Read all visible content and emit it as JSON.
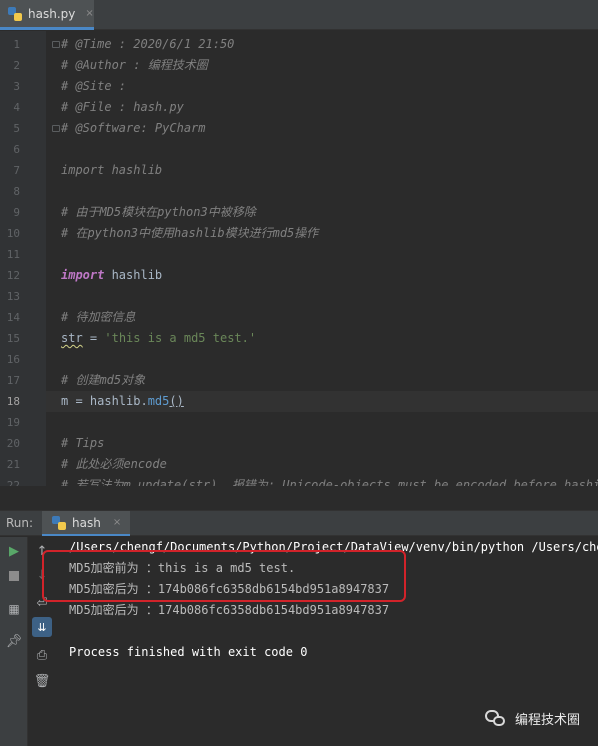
{
  "editor_tab": {
    "label": "hash.py",
    "close": "×",
    "icon": "python-file-icon"
  },
  "code": {
    "lines": [
      {
        "n": "1",
        "html": "comment",
        "text": "# @Time : 2020/6/1 21:50"
      },
      {
        "n": "2",
        "text": "# @Author : 编程技术圈"
      },
      {
        "n": "3",
        "text": "# @Site :"
      },
      {
        "n": "4",
        "text": "# @File : hash.py"
      },
      {
        "n": "5",
        "text": "# @Software: PyCharm"
      },
      {
        "n": "6",
        "text": ""
      },
      {
        "n": "7",
        "text": "import hashlib"
      },
      {
        "n": "8",
        "text": ""
      },
      {
        "n": "9",
        "text": "# 由于MD5模块在python3中被移除"
      },
      {
        "n": "10",
        "text": "# 在python3中使用hashlib模块进行md5操作"
      },
      {
        "n": "11",
        "text": ""
      },
      {
        "n": "12",
        "text": "import hashlib"
      },
      {
        "n": "13",
        "text": ""
      },
      {
        "n": "14",
        "text": "# 待加密信息"
      },
      {
        "n": "15",
        "text": "str = 'this is a md5 test.'"
      },
      {
        "n": "16",
        "text": ""
      },
      {
        "n": "17",
        "text": "# 创建md5对象"
      },
      {
        "n": "18",
        "text": "m = hashlib.md5()"
      },
      {
        "n": "19",
        "text": ""
      },
      {
        "n": "20",
        "text": "# Tips"
      },
      {
        "n": "21",
        "text": "# 此处必须encode"
      },
      {
        "n": "22",
        "text": "# 若写法为m.update(str)  报错为: Unicode-objects must be encoded before hashing"
      }
    ],
    "current_line": "18"
  },
  "run_panel": {
    "label": "Run:",
    "tab_label": "hash",
    "tab_close": "×",
    "output": [
      "/Users/chengf/Documents/Python/Project/DataView/venv/bin/python /Users/chengf/Documents/Python/Project/DataView/hash.py",
      "MD5加密前为 ：this is a md5 test.",
      "MD5加密后为 ：174b086fc6358db6154bd951a8947837",
      "MD5加密后为 ：174b086fc6358db6154bd951a8947837",
      "",
      "Process finished with exit code 0"
    ]
  },
  "watermark": {
    "text": "编程技术圈",
    "icon": "wechat-icon"
  },
  "colors": {
    "highlight_box": "#d2232a",
    "accent": "#4a88c7"
  }
}
